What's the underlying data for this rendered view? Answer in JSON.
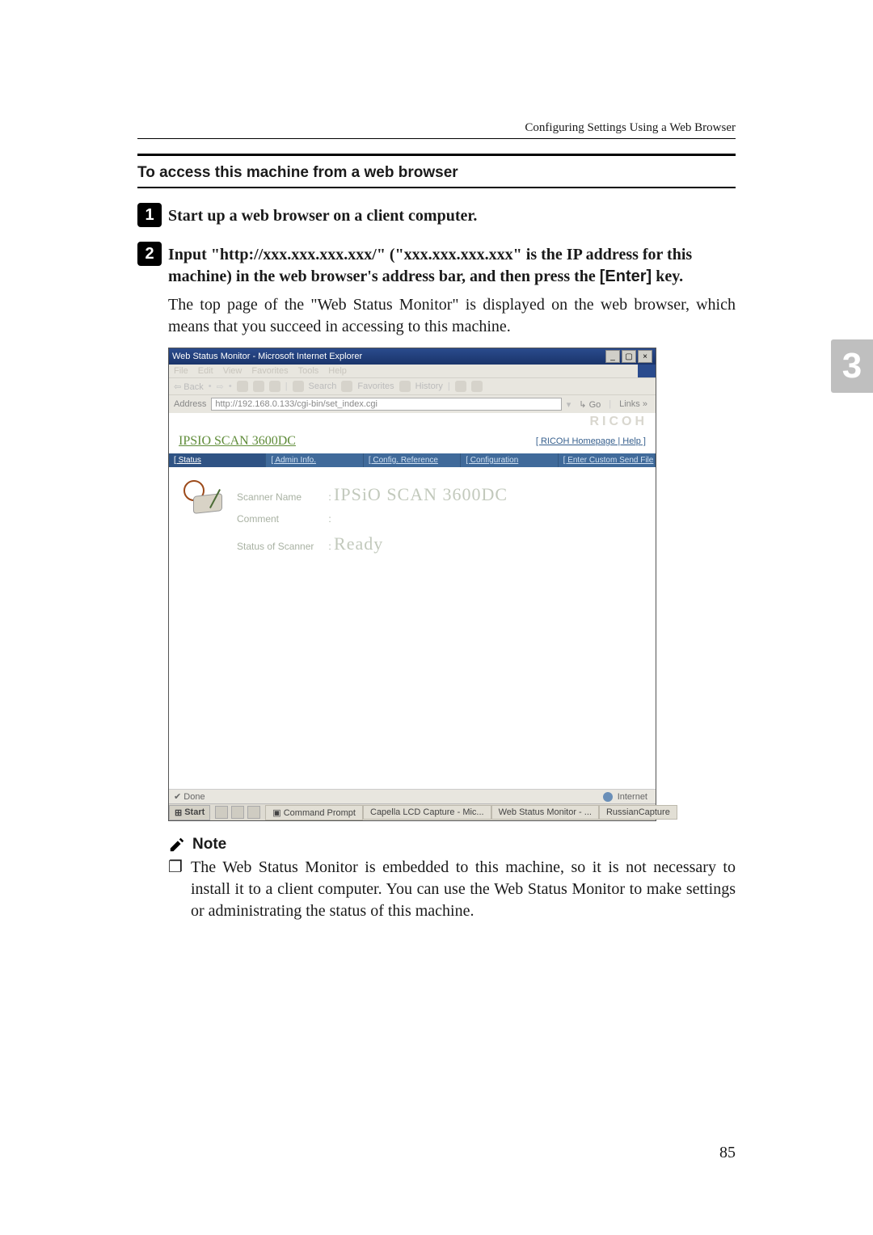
{
  "running_head": "Configuring Settings Using a Web Browser",
  "section_title": "To access this machine from a web browser",
  "steps": [
    {
      "num": "1",
      "body_html": "Start up a web browser on a client computer."
    },
    {
      "num": "2",
      "body_html": "Input \"http://xxx.xxx.xxx.xxx/\" (\"xxx.xxx.xxx.xxx\" is the IP address for this machine) in the web browser's address bar, and then press the [Enter] key."
    }
  ],
  "step2_para": "The top page of the \"Web Status Monitor\" is displayed on the web browser, which means that you succeed in accessing to this machine.",
  "browser": {
    "title": "Web Status Monitor - Microsoft Internet Explorer",
    "menus": [
      "File",
      "Edit",
      "View",
      "Favorites",
      "Tools",
      "Help"
    ],
    "toolbar_items": [
      "Back",
      "Search",
      "Favorites",
      "History"
    ],
    "address_label": "Address",
    "address_value": "http://192.168.0.133/cgi-bin/set_index.cgi",
    "go_label": "Go",
    "links_label": "Links",
    "brand": "RICOH",
    "model": "IPSIO SCAN 3600DC",
    "top_links": "RICOH Homepage | Help",
    "tabs": [
      "Status",
      "Admin Info.",
      "Config. Reference",
      "Configuration",
      "Enter Custom Send File"
    ],
    "content": {
      "rows": [
        {
          "label": "Scanner Name",
          "value": "IPSiO SCAN 3600DC"
        },
        {
          "label": "Comment",
          "value": ":"
        },
        {
          "label": "Status of Scanner",
          "value": "Ready"
        }
      ]
    },
    "status_left": "Done",
    "status_right": "Internet",
    "taskbar": {
      "start": "Start",
      "items": [
        "Command Prompt",
        "Capella LCD Capture - Mic...",
        "Web Status Monitor - ...",
        "RussianCapture"
      ]
    }
  },
  "note": {
    "heading": "Note",
    "item": "The Web Status Monitor is embedded to this machine, so it is not necessary to install it to a client computer. You can use the Web Status Monitor to make settings or administrating the status of this machine."
  },
  "side_tab": "3",
  "page_number": "85",
  "chart_data": null
}
